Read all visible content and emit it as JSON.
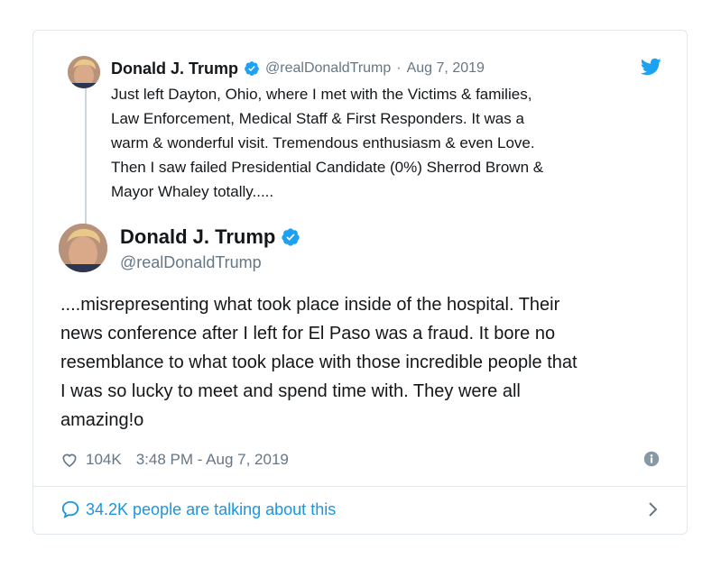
{
  "parent_tweet": {
    "author_name": "Donald J. Trump",
    "handle": "@realDonaldTrump",
    "separator": "·",
    "date": "Aug 7, 2019",
    "lines": [
      "Just left Dayton, Ohio, where I met with the Victims & families,",
      "Law Enforcement, Medical Staff & First Responders. It was a",
      "warm & wonderful visit. Tremendous enthusiasm & even Love.",
      "Then I saw failed Presidential Candidate (0%) Sherrod Brown &",
      "Mayor Whaley totally....."
    ]
  },
  "main_tweet": {
    "author_name": "Donald J. Trump",
    "handle": "@realDonaldTrump",
    "lines": [
      "....misrepresenting what took place inside of the hospital. Their",
      "news conference after I left for El Paso was a fraud. It bore no",
      "resemblance to what took place with those incredible people that",
      "I was so lucky to meet and spend time with. They were all",
      "amazing!o"
    ],
    "likes": "104K",
    "timestamp": "3:48 PM - Aug 7, 2019"
  },
  "footer": {
    "talking_text": "34.2K people are talking about this"
  },
  "icons": {
    "verified": "verified-badge-icon",
    "bird": "twitter-bird-icon",
    "heart": "heart-icon",
    "info": "info-icon",
    "comment": "speech-bubble-icon",
    "chevron": "chevron-right-icon"
  },
  "colors": {
    "twitter_blue": "#1da1f2",
    "link_blue": "#1b95e0",
    "secondary_text": "#657786",
    "border": "#e1e8ed"
  }
}
